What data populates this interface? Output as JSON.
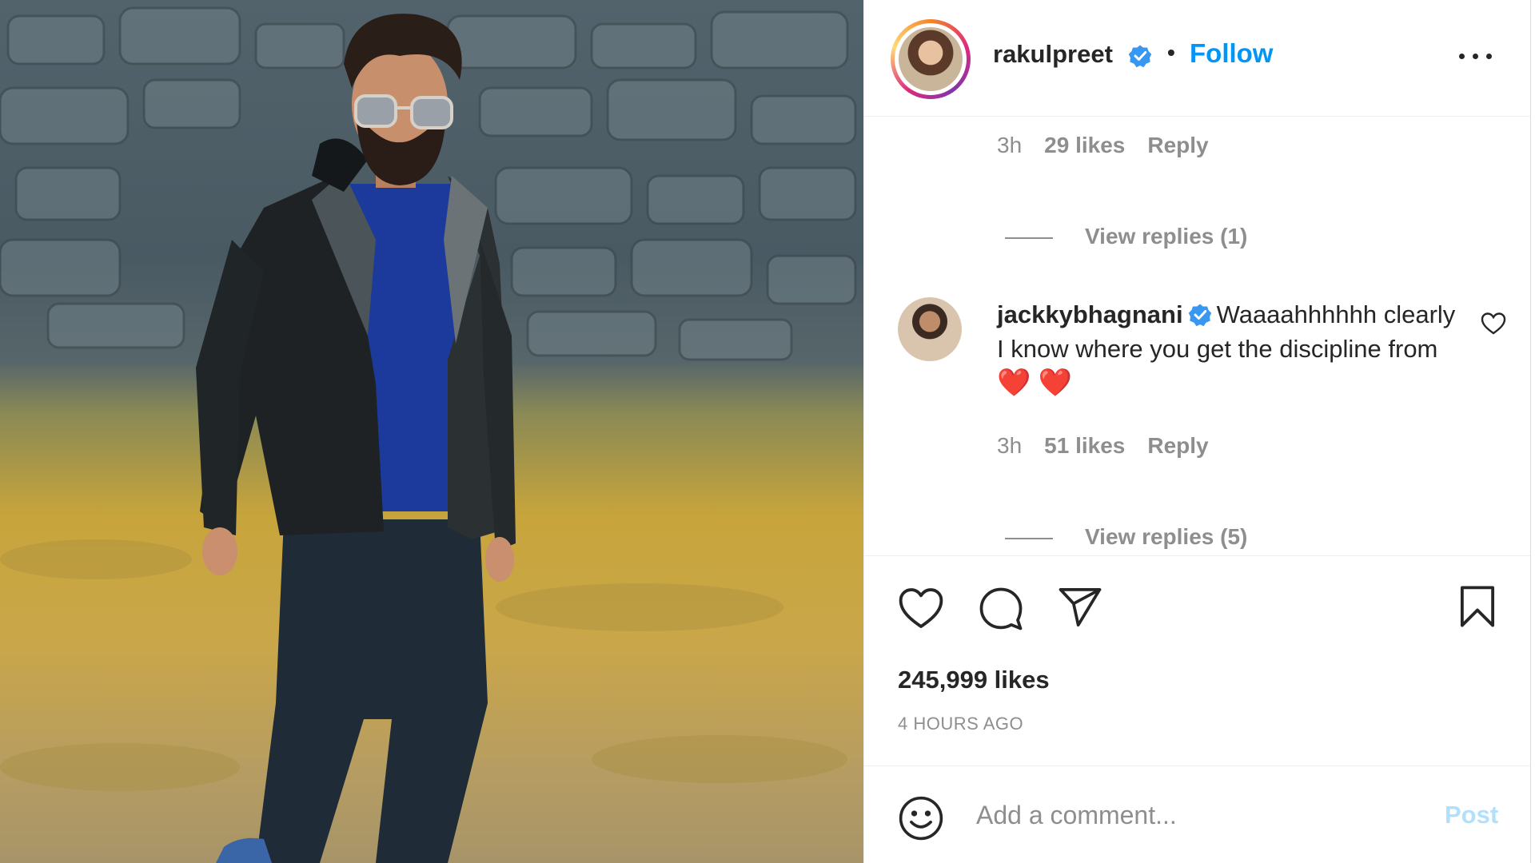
{
  "post": {
    "image_alt": "Man in sunglasses, black leather jacket and blue t-shirt walking on grass in front of a stone wall"
  },
  "header": {
    "username": "rakulpreet",
    "separator": "•",
    "follow_label": "Follow",
    "more_icon": "more-horizontal-icon"
  },
  "comments": {
    "previous_meta": {
      "time": "3h",
      "likes": "29 likes",
      "reply": "Reply"
    },
    "previous_view_replies": "View replies (1)",
    "items": [
      {
        "username": "jackkybhagnani",
        "text": "Waaaahhhhhh clearly I know where you get the discipline from",
        "emoji": "❤️ ❤️",
        "time": "3h",
        "likes": "51 likes",
        "reply": "Reply",
        "view_replies": "View replies (5)"
      }
    ]
  },
  "actions": {
    "icons": [
      "heart-icon",
      "comment-icon",
      "share-icon",
      "bookmark-icon"
    ],
    "likes": "245,999 likes",
    "posted_ago": "4 HOURS AGO"
  },
  "add_comment": {
    "placeholder": "Add a comment...",
    "post_label": "Post"
  },
  "colors": {
    "link_blue": "#0095f6",
    "post_disabled": "#b2dffc",
    "secondary_text": "#8e8e8e",
    "primary_text": "#262626",
    "verified": "#3897f0",
    "heart_red": "#e0001b"
  }
}
